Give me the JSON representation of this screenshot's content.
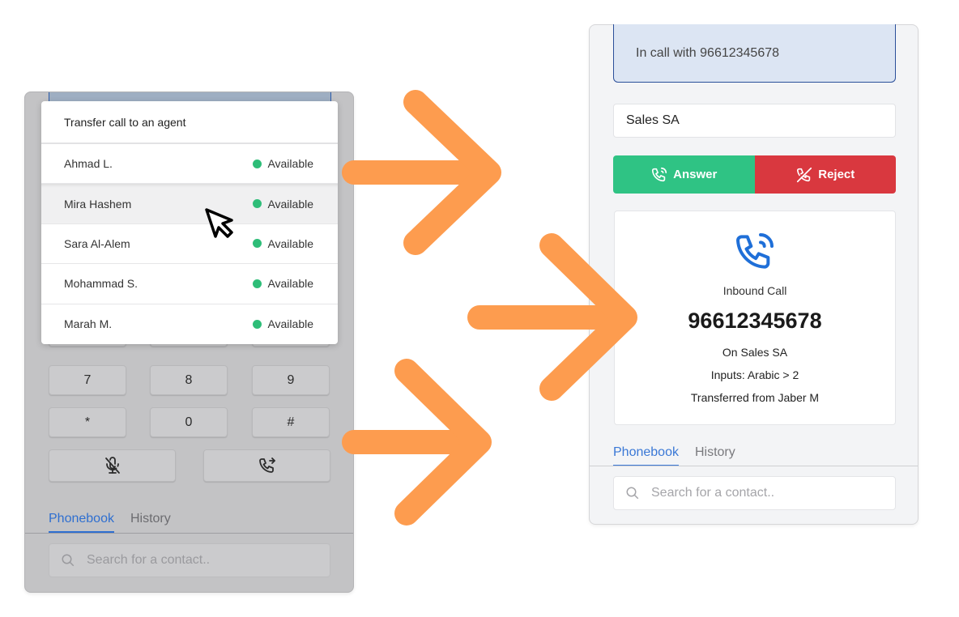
{
  "left_panel": {
    "transfer_menu": {
      "title": "Transfer call to an agent",
      "agents": [
        {
          "name": "Ahmad L.",
          "status": "Available"
        },
        {
          "name": "Mira Hashem",
          "status": "Available",
          "hovered": true
        },
        {
          "name": "Sara Al-Alem",
          "status": "Available"
        },
        {
          "name": "Mohammad S.",
          "status": "Available"
        },
        {
          "name": "Marah M.",
          "status": "Available"
        }
      ]
    },
    "keypad": {
      "keys": [
        "7",
        "8",
        "9",
        "*",
        "0",
        "#"
      ],
      "mute_icon": "mic-off-icon",
      "transfer_icon": "phone-forward-icon"
    },
    "tabs": [
      {
        "label": "Phonebook",
        "active": true
      },
      {
        "label": "History",
        "active": false
      }
    ],
    "search": {
      "placeholder": "Search for a contact.."
    }
  },
  "right_panel": {
    "banner": "In call with 96612345678",
    "queue": "Sales SA",
    "answer_label": "Answer",
    "reject_label": "Reject",
    "call": {
      "type": "Inbound Call",
      "number": "96612345678",
      "queue_line": "On Sales SA",
      "inputs_line": "Inputs: Arabic > 2",
      "transfer_line": "Transferred from Jaber M"
    },
    "tabs": [
      {
        "label": "Phonebook",
        "active": true
      },
      {
        "label": "History",
        "active": false
      }
    ],
    "search": {
      "placeholder": "Search for a contact.."
    }
  },
  "colors": {
    "arrow": "#fd9c4f",
    "answer": "#2fc384",
    "reject": "#d9383f",
    "available": "#2ebd78",
    "accent": "#2f6fd0"
  }
}
